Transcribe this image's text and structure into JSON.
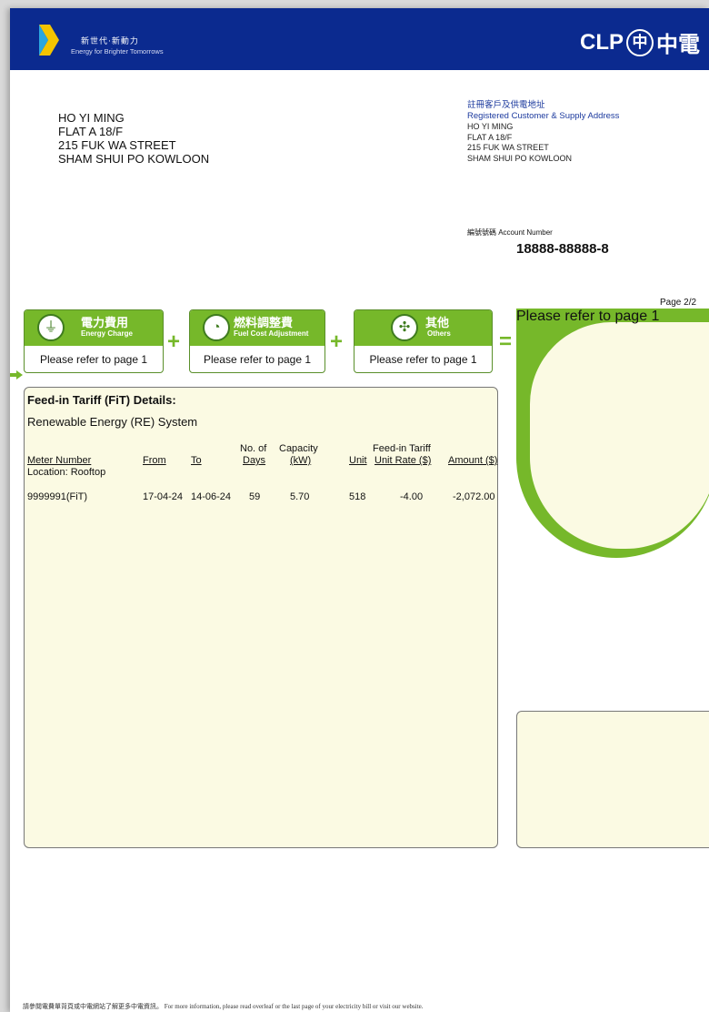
{
  "header": {
    "tagline_zh": "新世代‧新動力",
    "tagline_en": "Energy for Brighter Tomorrows",
    "logo_text": "CLP",
    "logo_circle": "中",
    "logo_zh": "中電"
  },
  "mailing_address": [
    "HO YI MING",
    "FLAT A 18/F",
    "215 FUK WA STREET",
    "SHAM SHUI PO KOWLOON"
  ],
  "registered": {
    "title_zh": "註冊客戶及供電地址",
    "title_en": "Registered Customer & Supply Address",
    "lines": [
      "HO YI MING",
      "FLAT A 18/F",
      "215 FUK WA STREET",
      "SHAM SHUI PO KOWLOON"
    ]
  },
  "account": {
    "label": "編號號碼 Account Number",
    "number": "18888-88888-8"
  },
  "page_number": "Page 2/2",
  "charges": [
    {
      "zh": "電力費用",
      "en": "Energy Charge",
      "icon": "plug-icon",
      "refer": "Please refer to page 1"
    },
    {
      "zh": "燃料調整費",
      "en": "Fuel Cost Adjustment",
      "icon": "gauge-icon",
      "refer": "Please refer to page 1"
    },
    {
      "zh": "其他",
      "en": "Others",
      "icon": "others-icon",
      "refer": "Please refer to page 1"
    }
  ],
  "total": {
    "refer": "Please refer to page 1"
  },
  "operators": {
    "plus": "+",
    "equals": "="
  },
  "fit": {
    "title": "Feed-in Tariff (FiT) Details:",
    "subtitle": "Renewable Energy (RE) System",
    "headers": {
      "meter": "Meter Number",
      "from": "From",
      "to": "To",
      "days_top": "No. of",
      "days": "Days",
      "cap_top": "Capacity",
      "cap": "(kW)",
      "unit": "Unit",
      "rate_top": "Feed-in Tariff",
      "rate": "Unit Rate ($)",
      "amount": "Amount ($)"
    },
    "location": "Location:  Rooftop",
    "row": {
      "meter": "9999991(FiT)",
      "from": "17-04-24",
      "to": "14-06-24",
      "days": "59",
      "capacity": "5.70",
      "unit": "518",
      "rate": "-4.00",
      "amount": "-2,072.00"
    }
  },
  "footer": "請參閱電費單背頁或中電網站了解更多中電資訊。 For more information, please read overleaf or the last page of your electricity bill or visit our website.",
  "colors": {
    "brand_blue": "#0b2a8f",
    "brand_green": "#76b82a",
    "panel_fill": "#fbfae3"
  }
}
